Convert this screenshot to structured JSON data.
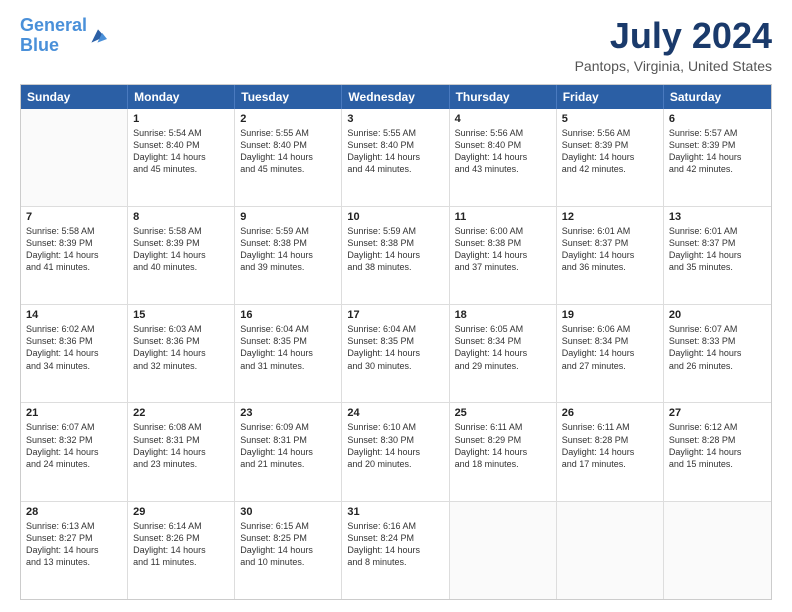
{
  "logo": {
    "line1": "General",
    "line2": "Blue"
  },
  "title": "July 2024",
  "subtitle": "Pantops, Virginia, United States",
  "header_days": [
    "Sunday",
    "Monday",
    "Tuesday",
    "Wednesday",
    "Thursday",
    "Friday",
    "Saturday"
  ],
  "weeks": [
    [
      {
        "day": "",
        "content": ""
      },
      {
        "day": "1",
        "content": "Sunrise: 5:54 AM\nSunset: 8:40 PM\nDaylight: 14 hours\nand 45 minutes."
      },
      {
        "day": "2",
        "content": "Sunrise: 5:55 AM\nSunset: 8:40 PM\nDaylight: 14 hours\nand 45 minutes."
      },
      {
        "day": "3",
        "content": "Sunrise: 5:55 AM\nSunset: 8:40 PM\nDaylight: 14 hours\nand 44 minutes."
      },
      {
        "day": "4",
        "content": "Sunrise: 5:56 AM\nSunset: 8:40 PM\nDaylight: 14 hours\nand 43 minutes."
      },
      {
        "day": "5",
        "content": "Sunrise: 5:56 AM\nSunset: 8:39 PM\nDaylight: 14 hours\nand 42 minutes."
      },
      {
        "day": "6",
        "content": "Sunrise: 5:57 AM\nSunset: 8:39 PM\nDaylight: 14 hours\nand 42 minutes."
      }
    ],
    [
      {
        "day": "7",
        "content": "Sunrise: 5:58 AM\nSunset: 8:39 PM\nDaylight: 14 hours\nand 41 minutes."
      },
      {
        "day": "8",
        "content": "Sunrise: 5:58 AM\nSunset: 8:39 PM\nDaylight: 14 hours\nand 40 minutes."
      },
      {
        "day": "9",
        "content": "Sunrise: 5:59 AM\nSunset: 8:38 PM\nDaylight: 14 hours\nand 39 minutes."
      },
      {
        "day": "10",
        "content": "Sunrise: 5:59 AM\nSunset: 8:38 PM\nDaylight: 14 hours\nand 38 minutes."
      },
      {
        "day": "11",
        "content": "Sunrise: 6:00 AM\nSunset: 8:38 PM\nDaylight: 14 hours\nand 37 minutes."
      },
      {
        "day": "12",
        "content": "Sunrise: 6:01 AM\nSunset: 8:37 PM\nDaylight: 14 hours\nand 36 minutes."
      },
      {
        "day": "13",
        "content": "Sunrise: 6:01 AM\nSunset: 8:37 PM\nDaylight: 14 hours\nand 35 minutes."
      }
    ],
    [
      {
        "day": "14",
        "content": "Sunrise: 6:02 AM\nSunset: 8:36 PM\nDaylight: 14 hours\nand 34 minutes."
      },
      {
        "day": "15",
        "content": "Sunrise: 6:03 AM\nSunset: 8:36 PM\nDaylight: 14 hours\nand 32 minutes."
      },
      {
        "day": "16",
        "content": "Sunrise: 6:04 AM\nSunset: 8:35 PM\nDaylight: 14 hours\nand 31 minutes."
      },
      {
        "day": "17",
        "content": "Sunrise: 6:04 AM\nSunset: 8:35 PM\nDaylight: 14 hours\nand 30 minutes."
      },
      {
        "day": "18",
        "content": "Sunrise: 6:05 AM\nSunset: 8:34 PM\nDaylight: 14 hours\nand 29 minutes."
      },
      {
        "day": "19",
        "content": "Sunrise: 6:06 AM\nSunset: 8:34 PM\nDaylight: 14 hours\nand 27 minutes."
      },
      {
        "day": "20",
        "content": "Sunrise: 6:07 AM\nSunset: 8:33 PM\nDaylight: 14 hours\nand 26 minutes."
      }
    ],
    [
      {
        "day": "21",
        "content": "Sunrise: 6:07 AM\nSunset: 8:32 PM\nDaylight: 14 hours\nand 24 minutes."
      },
      {
        "day": "22",
        "content": "Sunrise: 6:08 AM\nSunset: 8:31 PM\nDaylight: 14 hours\nand 23 minutes."
      },
      {
        "day": "23",
        "content": "Sunrise: 6:09 AM\nSunset: 8:31 PM\nDaylight: 14 hours\nand 21 minutes."
      },
      {
        "day": "24",
        "content": "Sunrise: 6:10 AM\nSunset: 8:30 PM\nDaylight: 14 hours\nand 20 minutes."
      },
      {
        "day": "25",
        "content": "Sunrise: 6:11 AM\nSunset: 8:29 PM\nDaylight: 14 hours\nand 18 minutes."
      },
      {
        "day": "26",
        "content": "Sunrise: 6:11 AM\nSunset: 8:28 PM\nDaylight: 14 hours\nand 17 minutes."
      },
      {
        "day": "27",
        "content": "Sunrise: 6:12 AM\nSunset: 8:28 PM\nDaylight: 14 hours\nand 15 minutes."
      }
    ],
    [
      {
        "day": "28",
        "content": "Sunrise: 6:13 AM\nSunset: 8:27 PM\nDaylight: 14 hours\nand 13 minutes."
      },
      {
        "day": "29",
        "content": "Sunrise: 6:14 AM\nSunset: 8:26 PM\nDaylight: 14 hours\nand 11 minutes."
      },
      {
        "day": "30",
        "content": "Sunrise: 6:15 AM\nSunset: 8:25 PM\nDaylight: 14 hours\nand 10 minutes."
      },
      {
        "day": "31",
        "content": "Sunrise: 6:16 AM\nSunset: 8:24 PM\nDaylight: 14 hours\nand 8 minutes."
      },
      {
        "day": "",
        "content": ""
      },
      {
        "day": "",
        "content": ""
      },
      {
        "day": "",
        "content": ""
      }
    ]
  ]
}
